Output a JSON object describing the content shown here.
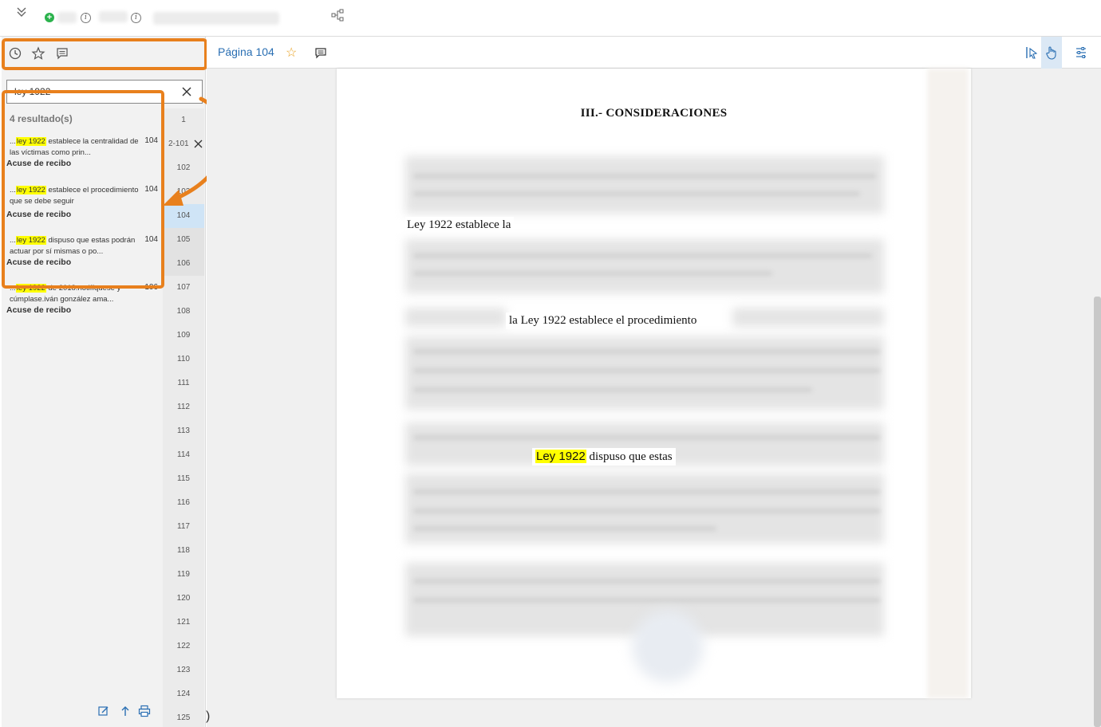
{
  "topbar": {
    "icons": [
      "collapse-chevrons-icon",
      "add-circle-icon",
      "info-icon",
      "hierarchy-tree-icon"
    ]
  },
  "sidebar": {
    "tool_icons": [
      "history-clock-icon",
      "favorites-star-icon",
      "comments-icon"
    ],
    "search": {
      "value": "ley 1922",
      "placeholder": ""
    },
    "results_count": "4 resultado(s)",
    "results": [
      {
        "before": "...",
        "highlight": "ley 1922",
        "after": " establece la centralidad de las víctimas como prin...",
        "page": "104",
        "source": "Acuse de recibo"
      },
      {
        "before": "...",
        "highlight": "ley 1922",
        "after": " establece el procedimiento que se debe seguir",
        "page": "104",
        "source": "Acuse de recibo"
      },
      {
        "before": "...",
        "highlight": "ley 1922",
        "after": " dispuso que estas podrán actuar por sí mismas o po...",
        "page": "104",
        "source": "Acuse de recibo"
      },
      {
        "before": "...",
        "highlight": "ley 1922",
        "after": " de 2018.notifíquese y cúmplase.iván gonzález ama...",
        "page": "106",
        "source": "Acuse de recibo"
      }
    ],
    "pages": [
      "1",
      "2-101",
      "102",
      "103",
      "104",
      "105",
      "106",
      "107",
      "108",
      "109",
      "110",
      "111",
      "112",
      "113",
      "114",
      "115",
      "116",
      "117",
      "118",
      "119",
      "120",
      "121",
      "122",
      "123",
      "124",
      "125"
    ],
    "active_page": "104",
    "bottom_icons": [
      "edit-icon",
      "upload-icon",
      "print-icon"
    ]
  },
  "viewer_toolbar": {
    "page_label": "Página 104",
    "right_icons": [
      "text-select-icon",
      "hand-pan-icon",
      "settings-sliders-icon"
    ]
  },
  "document": {
    "heading": "III.- CONSIDERACIONES",
    "snippet1": "Ley 1922 establece la",
    "snippet2": "la Ley 1922 establece el procedimiento",
    "snippet3_highlight": "Ley 1922",
    "snippet3_after": "dispuso que estas"
  },
  "colors": {
    "highlight_frame": "#e8801d",
    "search_mark": "#ffff00",
    "active_page": "#cfe4f6",
    "link_blue": "#2a6fb3"
  },
  "footer_fragment": ")"
}
